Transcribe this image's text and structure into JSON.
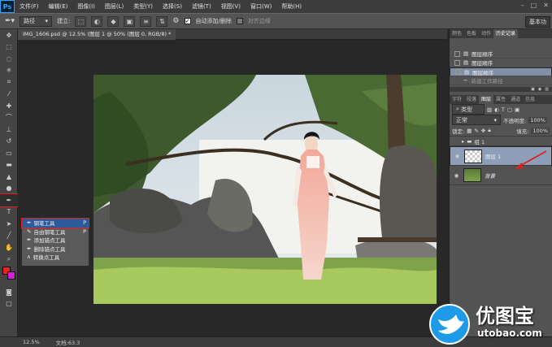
{
  "app": {
    "logo": "Ps"
  },
  "menu": [
    "文件(F)",
    "编辑(E)",
    "图像(I)",
    "图层(L)",
    "类型(Y)",
    "选择(S)",
    "滤镜(T)",
    "视图(V)",
    "窗口(W)",
    "帮助(H)"
  ],
  "options": {
    "mode_value": "路径",
    "build_label": "建立:",
    "auto_add_label": "自动添加/删除",
    "align_edges_label": "对齐边缘",
    "workspace_label": "基本功"
  },
  "document": {
    "tab_title": "IMG_1606.psd @ 12.5% (图层 1 @ 50% (图层 0, RGB/8) *"
  },
  "status": {
    "zoom": "12.5%",
    "doc_info": "文档:63.3"
  },
  "flyout": {
    "items": [
      {
        "label": "钢笔工具",
        "key": "P",
        "icon": "pen-icon"
      },
      {
        "label": "自由钢笔工具",
        "key": "P",
        "icon": "freeform-pen-icon"
      },
      {
        "label": "添加锚点工具",
        "key": "",
        "icon": "add-anchor-icon"
      },
      {
        "label": "删除锚点工具",
        "key": "",
        "icon": "delete-anchor-icon"
      },
      {
        "label": "转换点工具",
        "key": "",
        "icon": "convert-point-icon"
      }
    ]
  },
  "panels": {
    "top_tabs": [
      "颜色",
      "色板",
      "动作",
      "历史记录"
    ],
    "history": [
      {
        "label": "图层顺序"
      },
      {
        "label": "图层顺序"
      },
      {
        "label": "图层顺序"
      },
      {
        "label": "新建工作路径"
      }
    ],
    "layer_tabs": [
      "字符",
      "段落",
      "图层",
      "属性",
      "通道",
      "信息"
    ],
    "kind_label": "类型",
    "blend_mode": "正常",
    "opacity_label": "不透明度:",
    "opacity_value": "100%",
    "lock_label": "锁定:",
    "fill_label": "填充:",
    "fill_value": "100%",
    "group_name": "组 1",
    "layers": [
      {
        "name": "图层 1"
      },
      {
        "name": "背景"
      }
    ]
  },
  "watermark": {
    "text": "优图宝",
    "url": "utobao.com"
  },
  "colors": {
    "accent_red": "#e02020",
    "selected_blue": "#2d5a9a",
    "fg_color": "#e8251f",
    "bg_color": "#d81fd8"
  }
}
